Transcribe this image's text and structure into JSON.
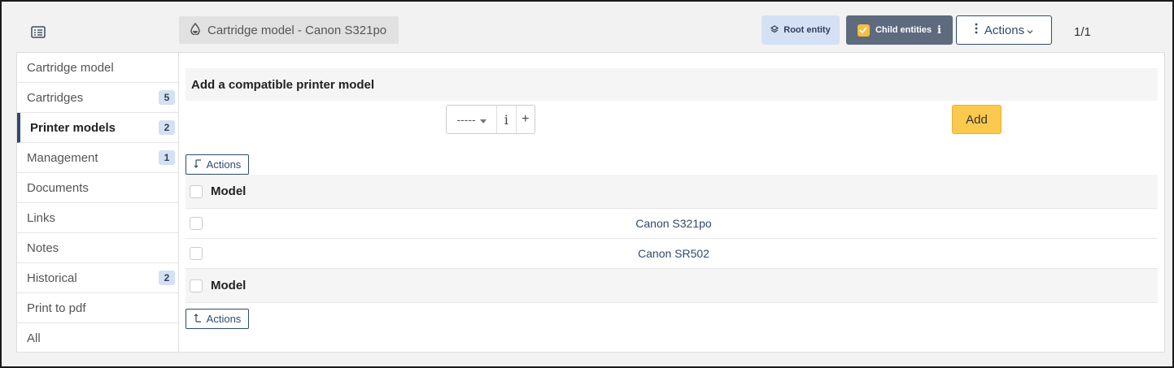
{
  "header": {
    "item_title": "Cartridge model - Canon S321po",
    "root_entity_label": "Root entity",
    "child_entities_label": "Child entities",
    "actions_label": "Actions",
    "pager": "1/1"
  },
  "sidebar": {
    "items": [
      {
        "label": "Cartridge model",
        "count": ""
      },
      {
        "label": "Cartridges",
        "count": "5"
      },
      {
        "label": "Printer models",
        "count": "2"
      },
      {
        "label": "Management",
        "count": "1"
      },
      {
        "label": "Documents",
        "count": ""
      },
      {
        "label": "Links",
        "count": ""
      },
      {
        "label": "Notes",
        "count": ""
      },
      {
        "label": "Historical",
        "count": "2"
      },
      {
        "label": "Print to pdf",
        "count": ""
      },
      {
        "label": "All",
        "count": ""
      }
    ],
    "active_index": 2
  },
  "add_form": {
    "title": "Add a compatible printer model",
    "select_value": "-----",
    "info_glyph": "i",
    "plus_glyph": "+",
    "add_label": "Add"
  },
  "table": {
    "mass_actions_label": "Actions",
    "column_header": "Model",
    "rows": [
      {
        "model": "Canon S321po"
      },
      {
        "model": "Canon SR502"
      }
    ]
  },
  "colors": {
    "accent": "#2f4a6d",
    "add_button": "#fbc94d",
    "root_entity_bg": "#d4e1f4",
    "child_entities_bg": "#5e6a7d",
    "checkbox_checked": "#f7be3e"
  },
  "icons": [
    "list-icon",
    "ink-drop-icon",
    "layers-icon",
    "info-icon",
    "dots-vertical-icon",
    "chevron-down-icon",
    "corner-down-left-icon",
    "corner-up-left-icon",
    "plus-icon",
    "caret-down-icon"
  ]
}
